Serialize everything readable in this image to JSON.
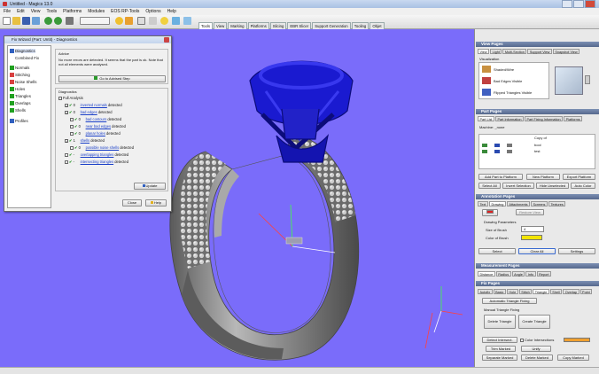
{
  "window": {
    "title": "Untitled - Magics 13.0"
  },
  "menu": [
    "File",
    "Edit",
    "View",
    "Tools",
    "Platforms",
    "Modules",
    "EOS RP-Tools",
    "Options",
    "Help"
  ],
  "ribbon_tabs": [
    "Tools",
    "View",
    "Marking",
    "Platforms",
    "Slicing",
    "EBR Slicer",
    "Support Generation",
    "Tooling",
    "Objet"
  ],
  "ribbon_active": 0,
  "fix_wizard": {
    "title": "Fix Wizard (Part: Untit) - Diagnostics",
    "side_items": [
      {
        "label": "Diagnostics",
        "status": "selected"
      },
      {
        "label": "Combined Fix",
        "status": "none"
      },
      {
        "label": "Normals",
        "status": "ok"
      },
      {
        "label": "Stitching",
        "status": "warn"
      },
      {
        "label": "Noise Shells",
        "status": "warn"
      },
      {
        "label": "Holes",
        "status": "ok"
      },
      {
        "label": "Triangles",
        "status": "ok"
      },
      {
        "label": "Overlaps",
        "status": "ok"
      },
      {
        "label": "Shells",
        "status": "ok"
      },
      {
        "label": "Profiles",
        "status": "none"
      }
    ],
    "advice_title": "Advice",
    "advice_text": "No more errors are detected. It seems that the part is ok. Note that not all elements were analysed.",
    "go_button": "Go to Advised Step",
    "diagnostics_title": "Diagnostics",
    "full_analysis": "Full Analysis",
    "rows": [
      {
        "link": "inverted normals",
        "suffix": "detected",
        "count": "0",
        "checked": true,
        "indent": 0
      },
      {
        "link": "bad edges",
        "suffix": "detected",
        "count": "0",
        "checked": true,
        "indent": 0
      },
      {
        "link": "bad contours",
        "suffix": "detected",
        "count": "0",
        "checked": false,
        "indent": 1
      },
      {
        "link": "near bad edges",
        "suffix": "detected",
        "count": "0",
        "checked": false,
        "indent": 1
      },
      {
        "link": "planar holes",
        "suffix": "detected",
        "count": "0",
        "checked": false,
        "indent": 1
      },
      {
        "link": "shells",
        "suffix": "detected",
        "count": "1",
        "checked": true,
        "indent": 0
      },
      {
        "link": "possible noise shells",
        "suffix": "detected",
        "count": "0",
        "checked": false,
        "indent": 1
      },
      {
        "link": "overlapping triangles",
        "suffix": "detected",
        "count": "-",
        "checked": false,
        "indent": 0
      },
      {
        "link": "intersecting triangles",
        "suffix": "detected",
        "count": "-",
        "checked": false,
        "indent": 0
      }
    ],
    "update_button": "Update",
    "close_button": "Close",
    "help_button": "Help"
  },
  "view_pages": {
    "title": "View Pages",
    "tabs": [
      "View",
      "Light",
      "Multi-Section",
      "Support View",
      "Snapshot View"
    ],
    "visualization": "Visualization",
    "options": [
      "Shaded/Wire",
      "Bad Edges Visible",
      "Flipped Triangles Visible"
    ]
  },
  "part_pages": {
    "title": "Part Pages",
    "tabs": [
      "Part List",
      "Part Information",
      "Part Fixing Information",
      "Platforms"
    ],
    "machine_label": "Machine: _none",
    "table_header": "Copy of",
    "rows": [
      "bool",
      "test"
    ],
    "buttons1": [
      "Add Part to Platform",
      "New Platform",
      "Export Platform"
    ],
    "buttons2": [
      "Select All",
      "Invert Selection",
      "Hide Unselected",
      "Auto Color"
    ]
  },
  "annotation_pages": {
    "title": "Annotation Pages",
    "tabs": [
      "Text",
      "Drawing",
      "Attachments",
      "Screens",
      "Textures"
    ],
    "restore_view": "Restore View",
    "drawing_parameters": "Drawing Parameters",
    "size_label": "Size of Brush",
    "size_value": "4",
    "color_label": "Color of Brush",
    "brush_color": "#f2e400",
    "buttons": [
      "Select",
      "Clear All",
      "Settings"
    ]
  },
  "measurement_pages": {
    "title": "Measurement Pages",
    "tabs": [
      "Distance",
      "Radius",
      "Angle",
      "Info",
      "Report"
    ]
  },
  "fix_pages": {
    "title": "Fix Pages",
    "tabs": [
      "Autofix",
      "Basic",
      "Hole",
      "Stitch",
      "Triangle",
      "Shell",
      "Overlap",
      "Point"
    ],
    "active_tab": "Triangle",
    "automatic_button": "Automatic Triangle Fixing",
    "manual_label": "Manual Triangle Fixing",
    "delete_button": "Delete Triangle",
    "create_button": "Create Triangle",
    "detect_button": "Detect Intersect.",
    "color_intersections": "Color Intersections",
    "intersect_color": "#f0a030",
    "trim_button": "Trim Marked",
    "unify_button": "Unify",
    "separate_button": "Separate Marked",
    "delete_marked": "Delete Marked",
    "copy_marked": "Copy Marked"
  },
  "colors": {
    "viewport": "#7a6cfa",
    "crown": "#1a1ad0",
    "ring": "#8d8d8d",
    "panel_header": "#5a6c92"
  }
}
